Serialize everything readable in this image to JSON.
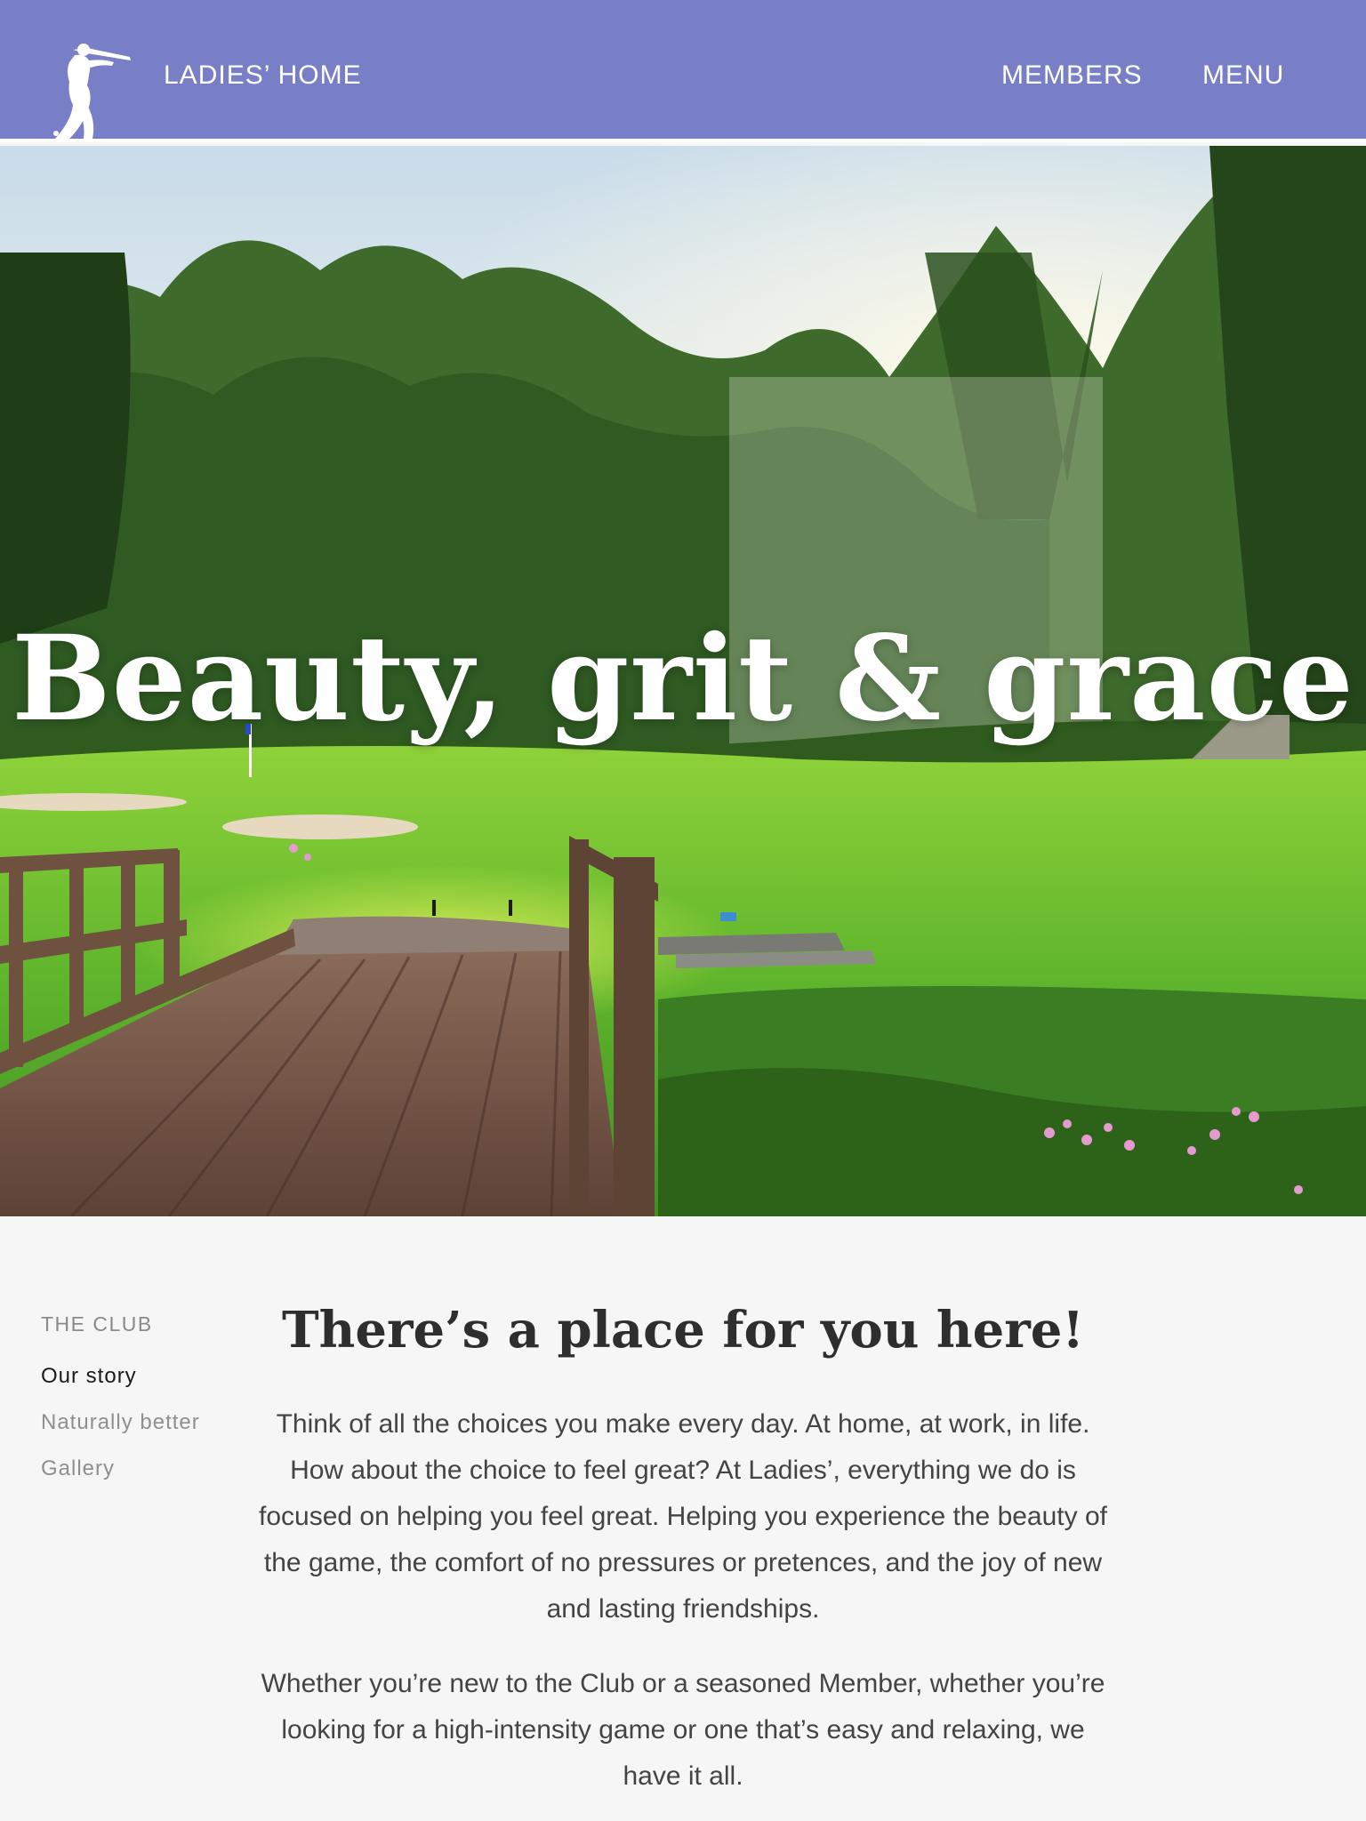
{
  "header": {
    "site_title": "LADIES’ HOME",
    "logo_icon": "golfer-silhouette-logo-icon",
    "nav": {
      "members": "MEMBERS",
      "menu": "MENU"
    },
    "background_color": "#787fc6"
  },
  "hero": {
    "headline": "Beauty, grit & grace"
  },
  "sidebar": {
    "heading": "THE CLUB",
    "items": [
      {
        "label": "Our story",
        "active": true
      },
      {
        "label": "Naturally better",
        "active": false
      },
      {
        "label": "Gallery",
        "active": false
      }
    ]
  },
  "main": {
    "title": "There’s a place for you here!",
    "paragraphs": [
      "Think of all the choices you make every day. At home, at work, in life. How about the choice to feel great? At Ladies’, everything we do is focused on helping you feel great. Helping you experience the beauty of the game, the comfort of no pressures or pretences, and the joy of new and lasting friendships.",
      "Whether you’re new to the Club or a seasoned Member, whether you’re looking for a high-intensity game or one that’s easy and relaxing, we have it all."
    ]
  }
}
